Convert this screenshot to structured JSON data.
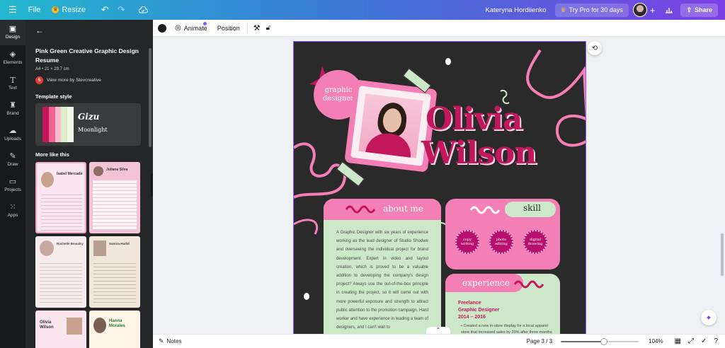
{
  "topbar": {
    "menu_icon": "hamburger-icon",
    "file_label": "File",
    "resize_label": "Resize",
    "user_name": "Kateryna Hordiienko",
    "try_pro_label": "Try Pro for 30 days",
    "share_label": "Share"
  },
  "rail": {
    "items": [
      {
        "label": "Design",
        "icon": "design-icon"
      },
      {
        "label": "Elements",
        "icon": "elements-icon"
      },
      {
        "label": "Text",
        "icon": "text-icon"
      },
      {
        "label": "Brand",
        "icon": "brand-icon"
      },
      {
        "label": "Uploads",
        "icon": "uploads-icon"
      },
      {
        "label": "Draw",
        "icon": "draw-icon"
      },
      {
        "label": "Projects",
        "icon": "projects-icon"
      },
      {
        "label": "Apps",
        "icon": "apps-icon"
      }
    ]
  },
  "panel": {
    "template_title": "Pink Green Creative Graphic Design Resume",
    "template_size": "A4 • 21 × 29.7 cm",
    "creator_initial": "S",
    "creator_link": "View more by Stevcreative",
    "style_heading": "Template style",
    "style_font_1": "Gizu",
    "style_font_2": "Moonlight",
    "palette": [
      "#c2185b",
      "#f06292",
      "#f8bbd0",
      "#dcedc8",
      "#f1f8e9"
    ],
    "more_heading": "More like this",
    "thumbs": [
      {
        "name": "Isabel Mercado"
      },
      {
        "name": "Juliana Silva"
      },
      {
        "name": "Rachelle Beaudry"
      },
      {
        "name": "Samira Hadid"
      },
      {
        "name": "Olivia Wilson"
      },
      {
        "name": "Hanna Morales"
      }
    ]
  },
  "toolbar": {
    "animate_label": "Animate",
    "position_label": "Position"
  },
  "resume": {
    "badge_line1": "graphic",
    "badge_line2": "designer",
    "first_name": "Olivia",
    "last_name": "Wilson",
    "about_heading": "about me",
    "about_text": "A Graphic Designer with six years of experience working as the lead designer of Studio Shodwe and overseeing the individual project for brand development. Expert in video and layout creation, which is proved to be a valuable addition to developing the company's design project? Always use the out-of-the-box principle in creating the project, so it will come out with more powerful exposure and strength to attract public attention to the promotion campaign. Hard worker and have experience in leading a team of designers, and I can't wait to",
    "skill_heading": "skill",
    "skills": [
      "copy writing",
      "photo editing",
      "digital drawing"
    ],
    "experience_heading": "experience",
    "job_line1": "Freelance",
    "job_line2": "Graphic Designer",
    "job_years": "2014 – 2016",
    "job_bullet": "Created a new in-store display for a local apparel store that increased sales by 20% after three months of the installation."
  },
  "bottombar": {
    "notes_label": "Notes",
    "page_indicator": "Page 3 / 3",
    "zoom_level": "104%",
    "zoom_fraction": 0.55
  },
  "colors": {
    "accent": "#8b5cf6",
    "hot_pink": "#c2185b",
    "pink": "#f47fb6",
    "mint": "#cde8c8",
    "dark": "#2a2a2a"
  }
}
